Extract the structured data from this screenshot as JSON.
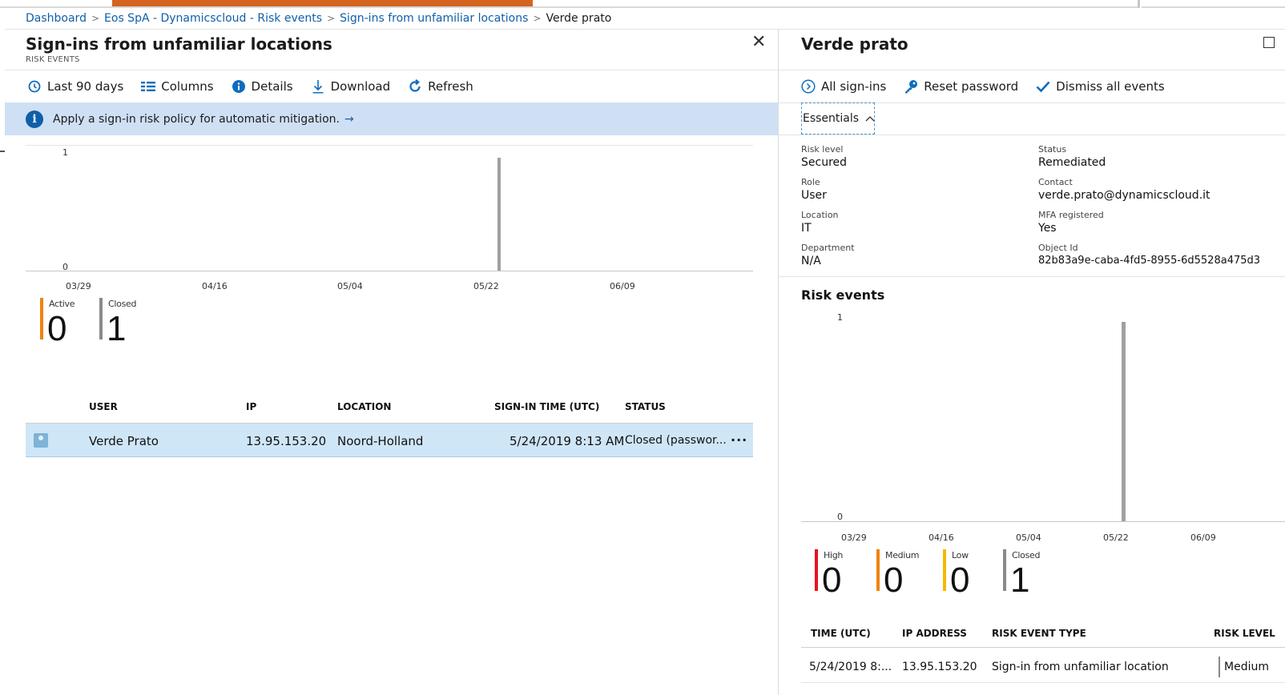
{
  "breadcrumb": {
    "items": [
      "Dashboard",
      "Eos SpA - Dynamicscloud - Risk events",
      "Sign-ins from unfamiliar locations"
    ],
    "current": "Verde prato"
  },
  "left_blade": {
    "title": "Sign-ins from unfamiliar locations",
    "subtitle": "RISK EVENTS",
    "commands": [
      {
        "label": "Last 90 days",
        "icon": "clock-icon"
      },
      {
        "label": "Columns",
        "icon": "columns-icon"
      },
      {
        "label": "Details",
        "icon": "info-icon"
      },
      {
        "label": "Download",
        "icon": "download-icon"
      },
      {
        "label": "Refresh",
        "icon": "refresh-icon"
      }
    ],
    "banner": {
      "text": "Apply a sign-in risk policy for automatic mitigation.",
      "arrow": "→"
    },
    "chart": {
      "y_max_label": "1",
      "y_min_label": "0",
      "x_ticks": [
        "03/29",
        "04/16",
        "05/04",
        "05/22",
        "06/09"
      ]
    },
    "tiles": [
      {
        "label": "Active",
        "value": "0",
        "color": "#f0830e"
      },
      {
        "label": "Closed",
        "value": "1",
        "color": "#8a8a8a"
      }
    ],
    "table": {
      "headers": [
        "USER",
        "IP",
        "LOCATION",
        "SIGN-IN TIME (UTC)",
        "STATUS"
      ],
      "rows": [
        {
          "user": "Verde Prato",
          "ip": "13.95.153.20",
          "location": "Noord-Holland",
          "time": "5/24/2019 8:13 AM",
          "status": "Closed (passwor...",
          "more": "..."
        }
      ]
    }
  },
  "right_blade": {
    "title": "Verde prato",
    "commands": [
      {
        "label": "All sign-ins",
        "icon": "arrow-circle-icon"
      },
      {
        "label": "Reset password",
        "icon": "key-icon"
      },
      {
        "label": "Dismiss all events",
        "icon": "checkmark-icon"
      }
    ],
    "essentials_label": "Essentials",
    "essentials": {
      "left": [
        {
          "label": "Risk level",
          "value": "Secured"
        },
        {
          "label": "Role",
          "value": "User"
        },
        {
          "label": "Location",
          "value": "IT"
        },
        {
          "label": "Department",
          "value": "N/A"
        }
      ],
      "right": [
        {
          "label": "Status",
          "value": "Remediated"
        },
        {
          "label": "Contact",
          "value": "verde.prato@dynamicscloud.it"
        },
        {
          "label": "MFA registered",
          "value": "Yes"
        },
        {
          "label": "Object Id",
          "value": "82b83a9e-caba-4fd5-8955-6d5528a475d3"
        }
      ]
    },
    "risk_events_title": "Risk events",
    "chart": {
      "y_max_label": "1",
      "y_min_label": "0",
      "x_ticks": [
        "03/29",
        "04/16",
        "05/04",
        "05/22",
        "06/09"
      ]
    },
    "tiles": [
      {
        "label": "High",
        "value": "0",
        "color": "#e81123"
      },
      {
        "label": "Medium",
        "value": "0",
        "color": "#f0830e"
      },
      {
        "label": "Low",
        "value": "0",
        "color": "#f5b800"
      },
      {
        "label": "Closed",
        "value": "1",
        "color": "#8a8a8a"
      }
    ],
    "table": {
      "headers": [
        "TIME (UTC)",
        "IP ADDRESS",
        "RISK EVENT TYPE",
        "RISK LEVEL"
      ],
      "rows": [
        {
          "time": "5/24/2019 8:...",
          "ip": "13.95.153.20",
          "type": "Sign-in from unfamiliar location",
          "level": "Medium"
        }
      ]
    }
  },
  "chart_data": [
    {
      "type": "bar",
      "x": [
        "5/24/2019"
      ],
      "values": [
        1
      ],
      "x_ticks": [
        "03/29",
        "04/16",
        "05/04",
        "05/22",
        "06/09"
      ],
      "ylim": [
        0,
        1
      ],
      "color": "#a0a0a0"
    },
    {
      "type": "bar",
      "x": [
        "5/24/2019"
      ],
      "values": [
        1
      ],
      "x_ticks": [
        "03/29",
        "04/16",
        "05/04",
        "05/22",
        "06/09"
      ],
      "ylim": [
        0,
        1
      ],
      "color": "#a0a0a0"
    }
  ]
}
